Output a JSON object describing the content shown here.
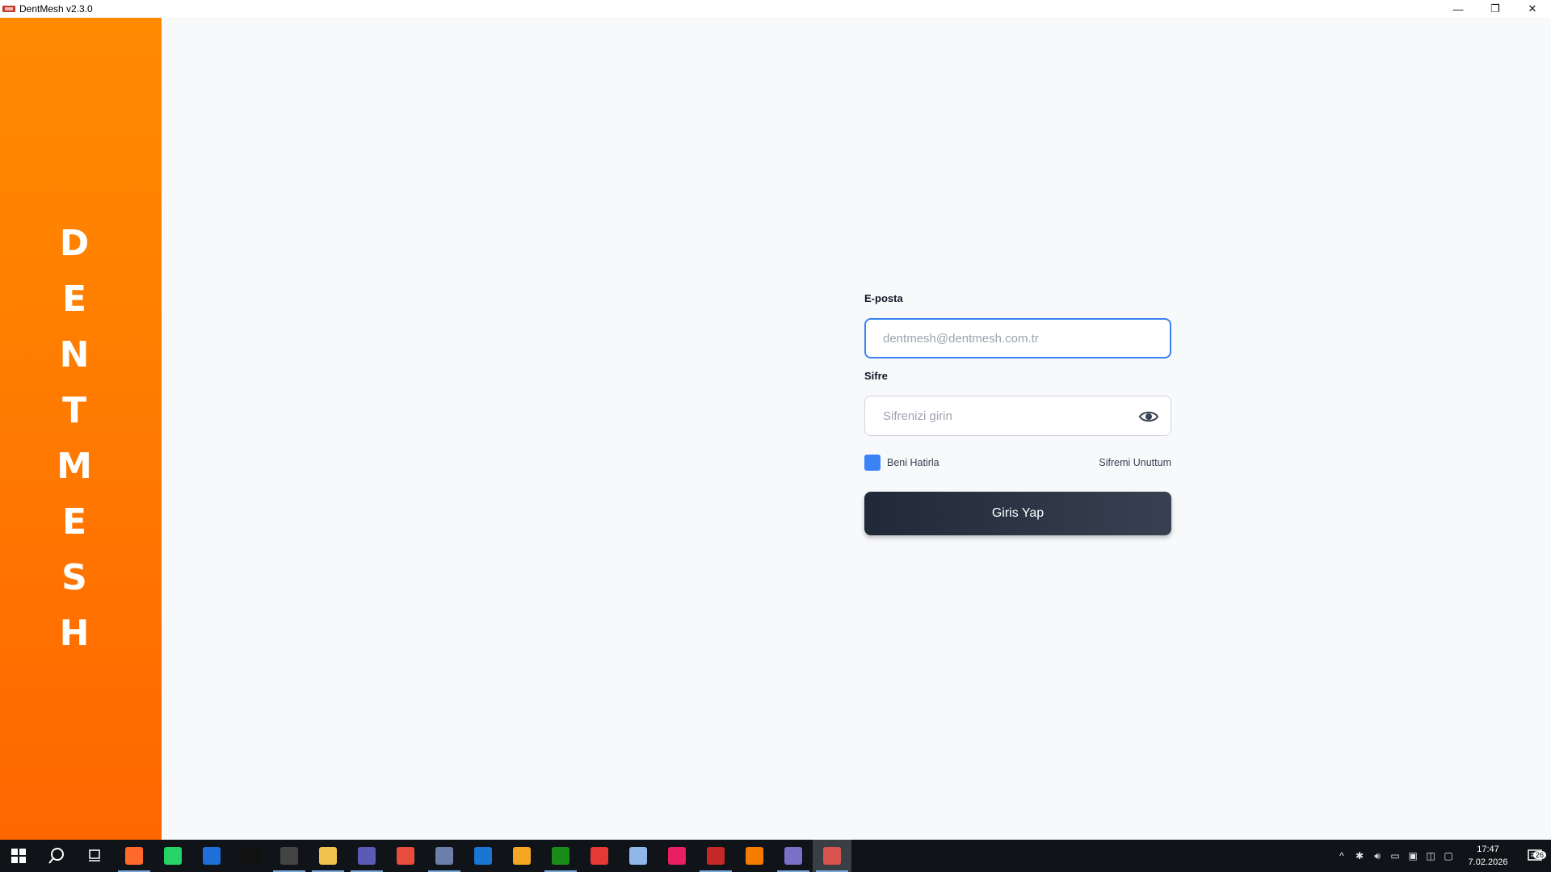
{
  "window": {
    "title": "DentMesh v2.3.0",
    "controls": {
      "minimize": "—",
      "restore": "❐",
      "close": "✕"
    }
  },
  "sidebar": {
    "brand_letters": [
      "D",
      "E",
      "N",
      "T",
      "M",
      "E",
      "S",
      "H"
    ],
    "gradient": [
      "#ff8a00",
      "#ff6600"
    ]
  },
  "login": {
    "email_label": "E-posta",
    "email_placeholder": "dentmesh@dentmesh.com.tr",
    "email_value": "",
    "password_label": "Sifre",
    "password_placeholder": "Sifrenizi girin",
    "password_value": "",
    "remember_label": "Beni Hatirla",
    "remember_checked": true,
    "forgot_label": "Sifremi Unuttum",
    "submit_label": "Giris Yap"
  },
  "colors": {
    "accent": "#3b82f6",
    "button_dark": "#1f2937",
    "orange": "#ff7a00"
  },
  "taskbar": {
    "apps": [
      {
        "name": "app-orange-icon",
        "color": "#ff6a2a",
        "running": true
      },
      {
        "name": "whatsapp-icon",
        "color": "#25d366",
        "running": false
      },
      {
        "name": "app-blue-r-icon",
        "color": "#1e6fd9",
        "running": false
      },
      {
        "name": "nc-icon",
        "color": "#111111",
        "running": false
      },
      {
        "name": "app-dark-icon",
        "color": "#444444",
        "running": true
      },
      {
        "name": "file-explorer-icon",
        "color": "#f2c14e",
        "running": true
      },
      {
        "name": "search-app-icon",
        "color": "#5b5bb5",
        "running": true
      },
      {
        "name": "chrome-icon",
        "color": "#e74c3c",
        "running": false
      },
      {
        "name": "exo-icon",
        "color": "#6b7fa8",
        "running": true
      },
      {
        "name": "mail-icon",
        "color": "#1976d2",
        "running": false
      },
      {
        "name": "arrow-app-icon",
        "color": "#f5a623",
        "running": false
      },
      {
        "name": "green-app-icon",
        "color": "#1a8c1a",
        "running": true
      },
      {
        "name": "red-arrow-app-icon",
        "color": "#e53935",
        "running": false
      },
      {
        "name": "notes-app-icon",
        "color": "#8fb8e8",
        "running": false
      },
      {
        "name": "pink-app-icon",
        "color": "#e91e63",
        "running": false
      },
      {
        "name": "sw-2024-icon",
        "color": "#c62828",
        "running": true
      },
      {
        "name": "blender-icon",
        "color": "#f57c00",
        "running": false
      },
      {
        "name": "cad-icon",
        "color": "#7b6fc7",
        "running": true
      },
      {
        "name": "dentmesh-taskbar-icon",
        "color": "#d9534f",
        "running": true,
        "active": true
      }
    ],
    "clock_time": "17:47",
    "clock_date": "7.02.2026",
    "notifications": "26"
  }
}
